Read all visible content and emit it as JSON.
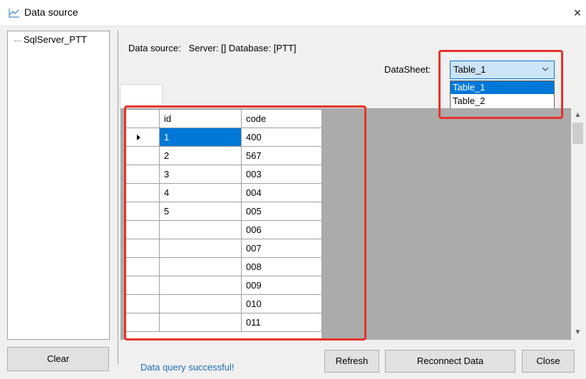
{
  "window": {
    "title": "Data source",
    "close_symbol": "×"
  },
  "tree": {
    "root_label": "SqlServer_PTT"
  },
  "info": {
    "data_source_text": "Data source:   Server: [] Database: [PTT]"
  },
  "datasheet": {
    "label": "DataSheet:",
    "selected": "Table_1",
    "options": [
      "Table_1",
      "Table_2"
    ]
  },
  "grid": {
    "columns": [
      "id",
      "code"
    ],
    "rows": [
      {
        "id": "1",
        "code": "400"
      },
      {
        "id": "2",
        "code": "567"
      },
      {
        "id": "3",
        "code": "003"
      },
      {
        "id": "4",
        "code": "004"
      },
      {
        "id": "5",
        "code": "005"
      },
      {
        "id": "",
        "code": "006"
      },
      {
        "id": "",
        "code": "007"
      },
      {
        "id": "",
        "code": "008"
      },
      {
        "id": "",
        "code": "009"
      },
      {
        "id": "",
        "code": "010"
      },
      {
        "id": "",
        "code": "011"
      }
    ]
  },
  "buttons": {
    "clear": "Clear",
    "refresh": "Refresh",
    "reconnect": "Reconnect Data",
    "close": "Close"
  },
  "status": {
    "text": "Data query successful!"
  },
  "colors": {
    "accent": "#0078d7",
    "annotation": "#e6332a",
    "status": "#1e6fba"
  }
}
